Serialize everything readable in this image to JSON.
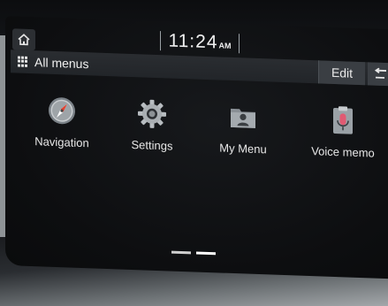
{
  "status": {
    "time": "11:24",
    "ampm": "AM"
  },
  "header": {
    "title": "All menus",
    "edit_label": "Edit"
  },
  "apps": [
    {
      "label": "Navigation",
      "icon": "compass-icon"
    },
    {
      "label": "Settings",
      "icon": "gear-icon"
    },
    {
      "label": "My Menu",
      "icon": "folder-user-icon"
    },
    {
      "label": "Voice memo",
      "icon": "microphone-icon"
    }
  ],
  "pager": {
    "pages": 2,
    "current": 2
  },
  "colors": {
    "screen_bg": "#0d0e10",
    "bar_bg": "#2a2d31",
    "text": "#f2f2f2"
  }
}
